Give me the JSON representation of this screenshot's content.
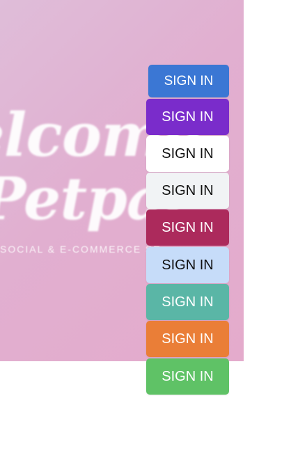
{
  "hero": {
    "line1": "elcome",
    "line2": "Petpal",
    "tagline": "SOCIAL & E-COMMERCE SE"
  },
  "buttons": [
    {
      "label": "SIGN IN",
      "bg": "#3b77d4",
      "color": "#ffffff"
    },
    {
      "label": "SIGN IN",
      "bg": "#7a2ccb",
      "color": "#ffffff"
    },
    {
      "label": "SIGN IN",
      "bg": "#ffffff",
      "color": "#111111"
    },
    {
      "label": "SIGN IN",
      "bg": "#f1f3f5",
      "color": "#111111"
    },
    {
      "label": "SIGN IN",
      "bg": "#ac2a5c",
      "color": "#ffffff"
    },
    {
      "label": "SIGN IN",
      "bg": "#c6dcf9",
      "color": "#111111"
    },
    {
      "label": "SIGN IN",
      "bg": "#5ab6a6",
      "color": "#ffffff"
    },
    {
      "label": "SIGN IN",
      "bg": "#ea7e37",
      "color": "#ffffff"
    },
    {
      "label": "SIGN IN",
      "bg": "#5fc266",
      "color": "#ffffff"
    }
  ]
}
